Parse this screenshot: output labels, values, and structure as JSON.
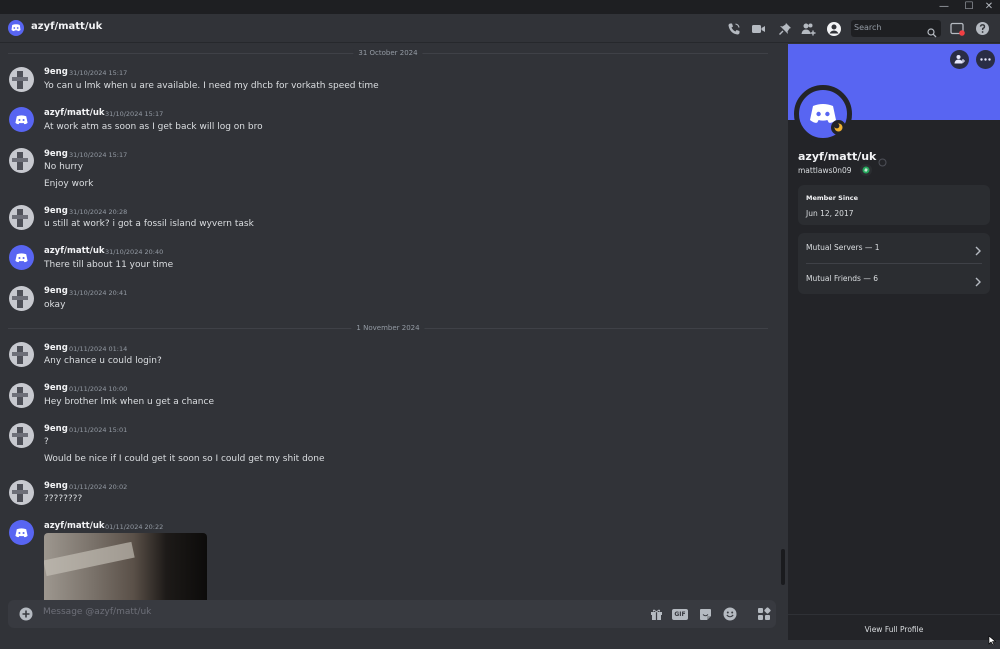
{
  "window": {
    "minimize": "—",
    "maximize": "☐",
    "close": "✕"
  },
  "header": {
    "title": "azyf/matt/uk",
    "search_placeholder": "Search"
  },
  "dividers": [
    "31 October 2024",
    "1 November 2024"
  ],
  "messages": [
    {
      "author": "9eng",
      "time": "31/10/2024 15:17",
      "lines": [
        "Yo can u lmk when u are available. I need my dhcb for vorkath speed time"
      ]
    },
    {
      "author": "azyf/matt/uk",
      "time": "31/10/2024 15:17",
      "lines": [
        "At work atm as soon as I get back will log on bro"
      ]
    },
    {
      "author": "9eng",
      "time": "31/10/2024 15:17",
      "lines": [
        "No hurry",
        "Enjoy work"
      ]
    },
    {
      "author": "9eng",
      "time": "31/10/2024 20:28",
      "lines": [
        "u still at work? i got a fossil island wyvern task"
      ]
    },
    {
      "author": "azyf/matt/uk",
      "time": "31/10/2024 20:40",
      "lines": [
        "There till about 11 your time"
      ]
    },
    {
      "author": "9eng",
      "time": "31/10/2024 20:41",
      "lines": [
        "okay"
      ]
    },
    {
      "author": "9eng",
      "time": "01/11/2024 01:14",
      "lines": [
        "Any chance u could login?"
      ]
    },
    {
      "author": "9eng",
      "time": "01/11/2024 10:00",
      "lines": [
        "Hey brother lmk when u get a chance"
      ]
    },
    {
      "author": "9eng",
      "time": "01/11/2024 15:01",
      "lines": [
        "?",
        "Would be nice if I could get it soon so I could get my shit done"
      ]
    },
    {
      "author": "9eng",
      "time": "01/11/2024 20:02",
      "lines": [
        "????????"
      ]
    },
    {
      "author": "azyf/matt/uk",
      "time": "01/11/2024 20:22",
      "lines": []
    }
  ],
  "composer": {
    "placeholder": "Message @azyf/matt/uk",
    "gif_label": "GIF"
  },
  "profile": {
    "display_name": "azyf/matt/uk",
    "username": "mattlaws0n09",
    "member_since_label": "Member Since",
    "member_since_value": "Jun 12, 2017",
    "mutual_servers": "Mutual Servers — 1",
    "mutual_friends": "Mutual Friends — 6",
    "view_full_profile": "View Full Profile"
  },
  "colors": {
    "accent": "#5865f2",
    "background": "#313338",
    "panel": "#232428",
    "status_idle": "#f0b232"
  }
}
